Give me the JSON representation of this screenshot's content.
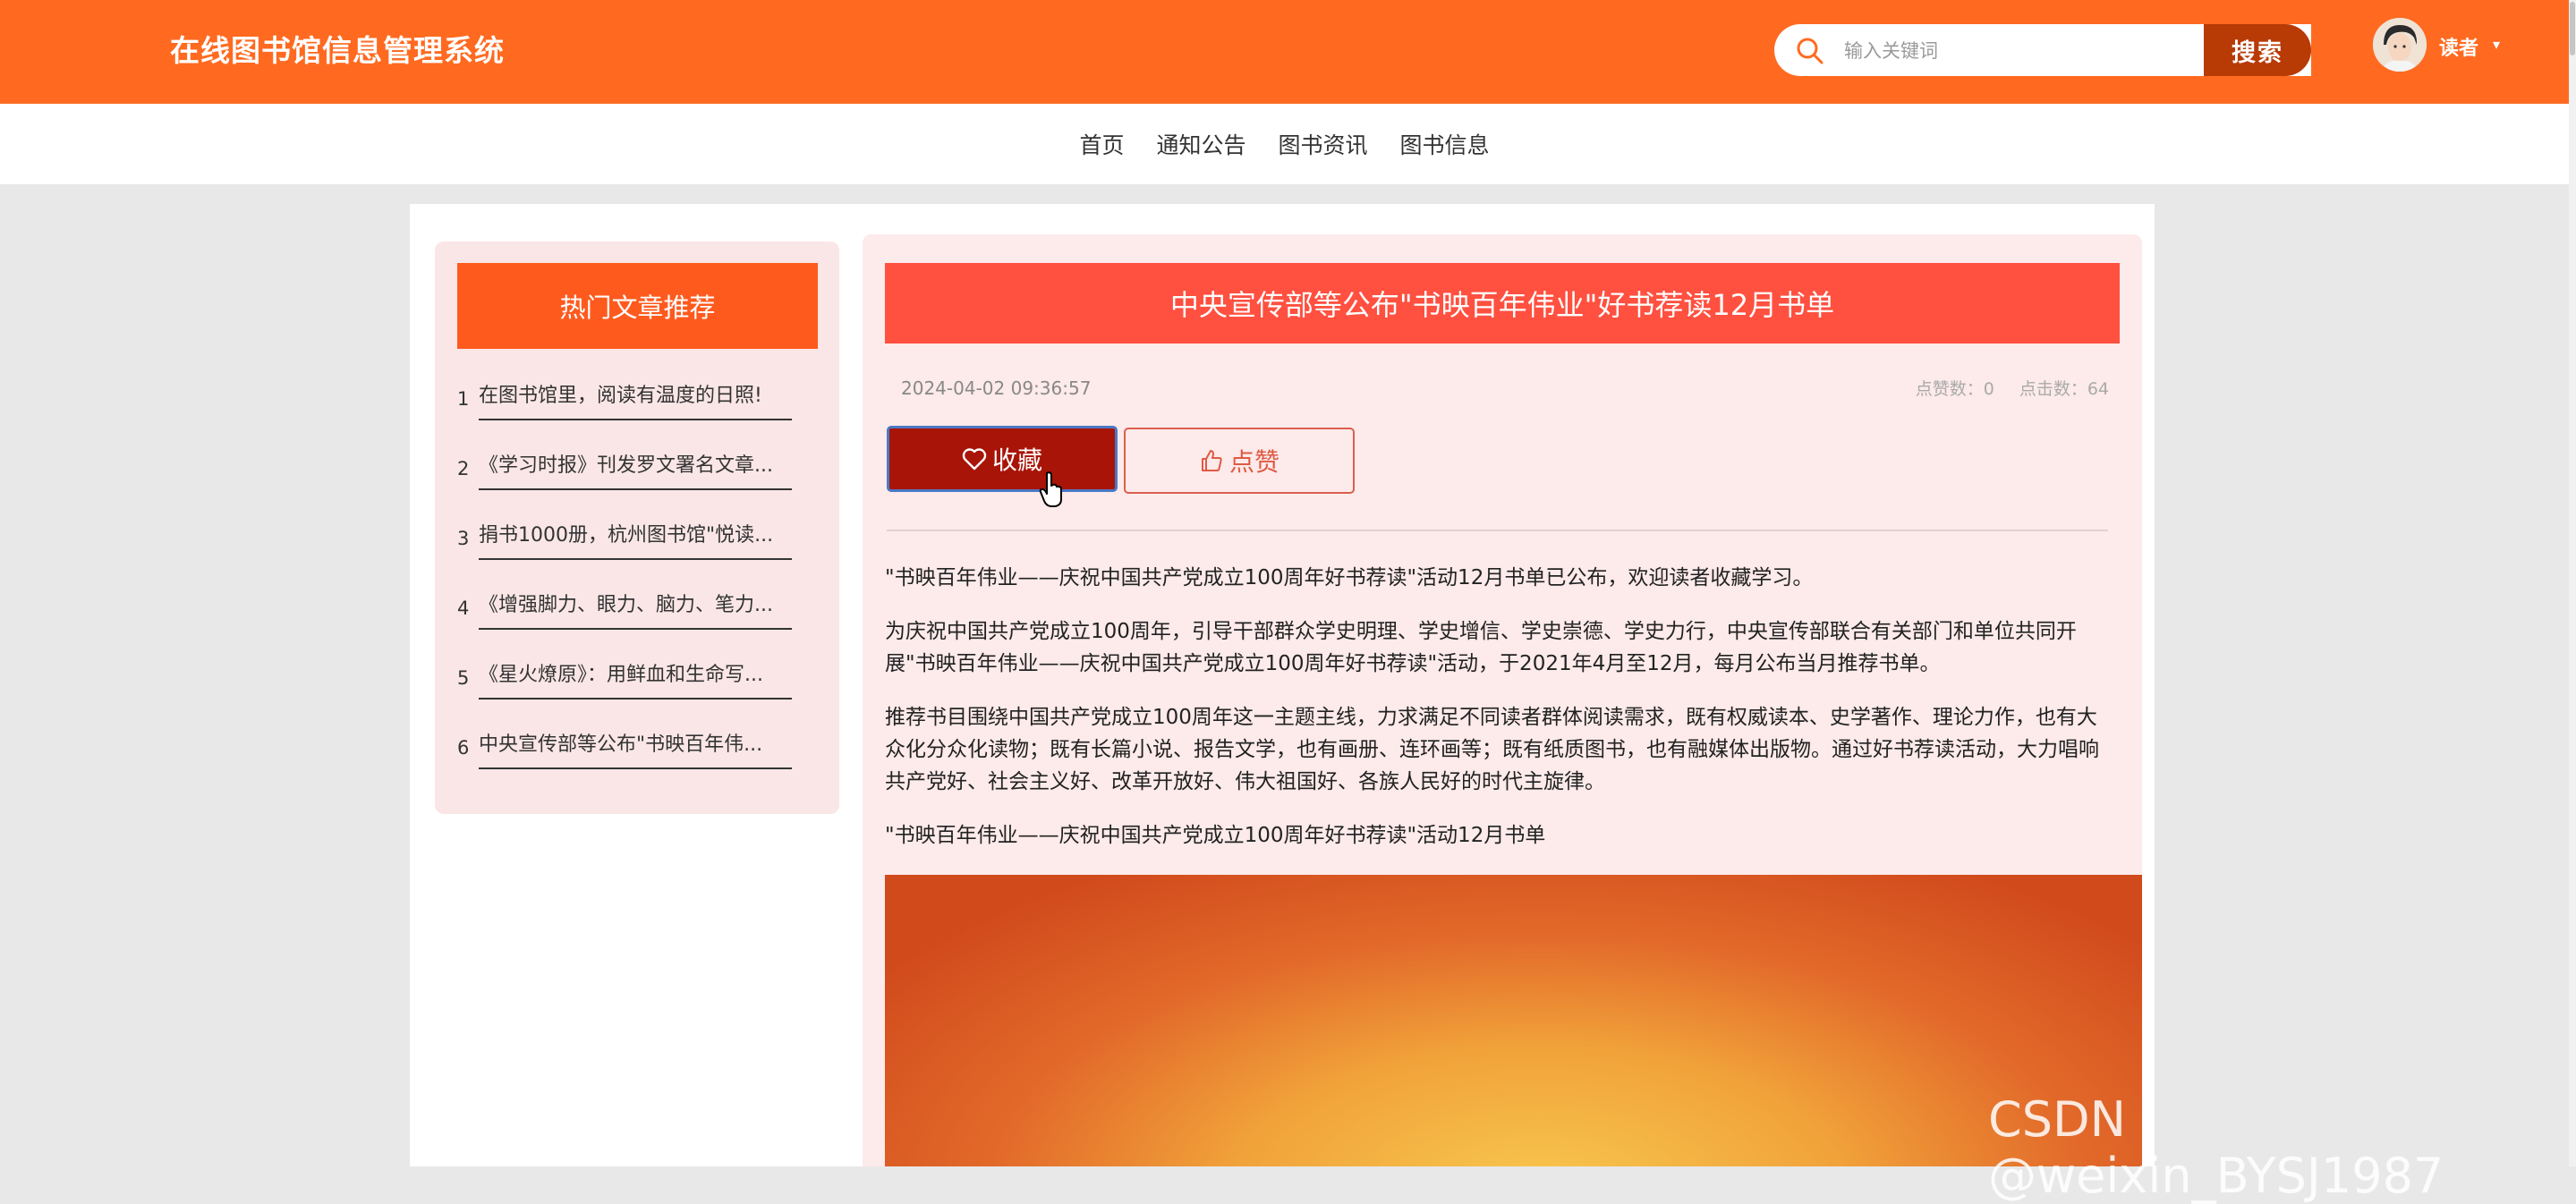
{
  "header": {
    "site_title": "在线图书馆信息管理系统",
    "search": {
      "placeholder": "输入关键词",
      "button_label": "搜索"
    },
    "user": {
      "name": "读者",
      "caret": "▾"
    }
  },
  "nav": {
    "items": [
      {
        "label": "首页"
      },
      {
        "label": "通知公告"
      },
      {
        "label": "图书资讯"
      },
      {
        "label": "图书信息"
      }
    ]
  },
  "sidebar": {
    "title": "热门文章推荐",
    "items": [
      {
        "num": "1",
        "text": "在图书馆里，阅读有温度的日照!"
      },
      {
        "num": "2",
        "text": "《学习时报》刊发罗文署名文章..."
      },
      {
        "num": "3",
        "text": "捐书1000册，杭州图书馆\"悦读..."
      },
      {
        "num": "4",
        "text": "《增强脚力、眼力、脑力、笔力..."
      },
      {
        "num": "5",
        "text": "《星火燎原》：用鲜血和生命写..."
      },
      {
        "num": "6",
        "text": "中央宣传部等公布\"书映百年伟..."
      }
    ]
  },
  "article": {
    "title": "中央宣传部等公布\"书映百年伟业\"好书荐读12月书单",
    "date": "2024-04-02 09:36:57",
    "likes_label": "点赞数：0",
    "clicks_label": "点击数：64",
    "favorite_label": "收藏",
    "like_label": "点赞",
    "paragraphs": [
      "\"书映百年伟业——庆祝中国共产党成立100周年好书荐读\"活动12月书单已公布，欢迎读者收藏学习。",
      "为庆祝中国共产党成立100周年，引导干部群众学史明理、学史增信、学史崇德、学史力行，中央宣传部联合有关部门和单位共同开展\"书映百年伟业——庆祝中国共产党成立100周年好书荐读\"活动，于2021年4月至12月，每月公布当月推荐书单。",
      "推荐书目围绕中国共产党成立100周年这一主题主线，力求满足不同读者群体阅读需求，既有权威读本、史学著作、理论力作，也有大众化分众化读物；既有长篇小说、报告文学，也有画册、连环画等；既有纸质图书，也有融媒体出版物。通过好书荐读活动，大力唱响共产党好、社会主义好、改革开放好、伟大祖国好、各族人民好的时代主旋律。",
      "\"书映百年伟业——庆祝中国共产党成立100周年好书荐读\"活动12月书单"
    ]
  },
  "watermark": "CSDN @weixin_BYSJ1987",
  "colors": {
    "header_bg": "#ff6a20",
    "search_button": "#b83a05",
    "sidebar_title_bg": "#ff5a1e",
    "article_title_bg": "#ff5040",
    "favorite_button": "#a81407",
    "panel_bg": "#fdeaea"
  }
}
